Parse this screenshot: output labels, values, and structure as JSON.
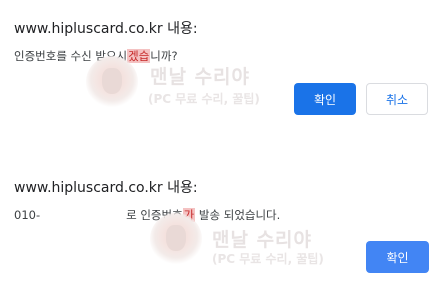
{
  "confirm_dialog": {
    "title": "www.hipluscard.co.kr 내용:",
    "message_before": "인증번호를 수신 받으시",
    "message_highlight": "겠습",
    "message_after": "니까?",
    "ok_label": "확인",
    "cancel_label": "취소"
  },
  "alert_dialog": {
    "title": "www.hipluscard.co.kr 내용:",
    "message_phone": "010-",
    "message_before": "로 인증번호",
    "message_highlight": "가",
    "message_after": " 발송 되었습니다.",
    "ok_label": "확인"
  },
  "watermark": {
    "title": "맨날 수리야",
    "subtitle": "(PC 무료 수리, 꿀팁)"
  },
  "colors": {
    "primary_button": "#1a73e8",
    "alert_button": "#4285f4",
    "highlight_bg": "#f4c2c2",
    "highlight_text": "#c62828"
  }
}
